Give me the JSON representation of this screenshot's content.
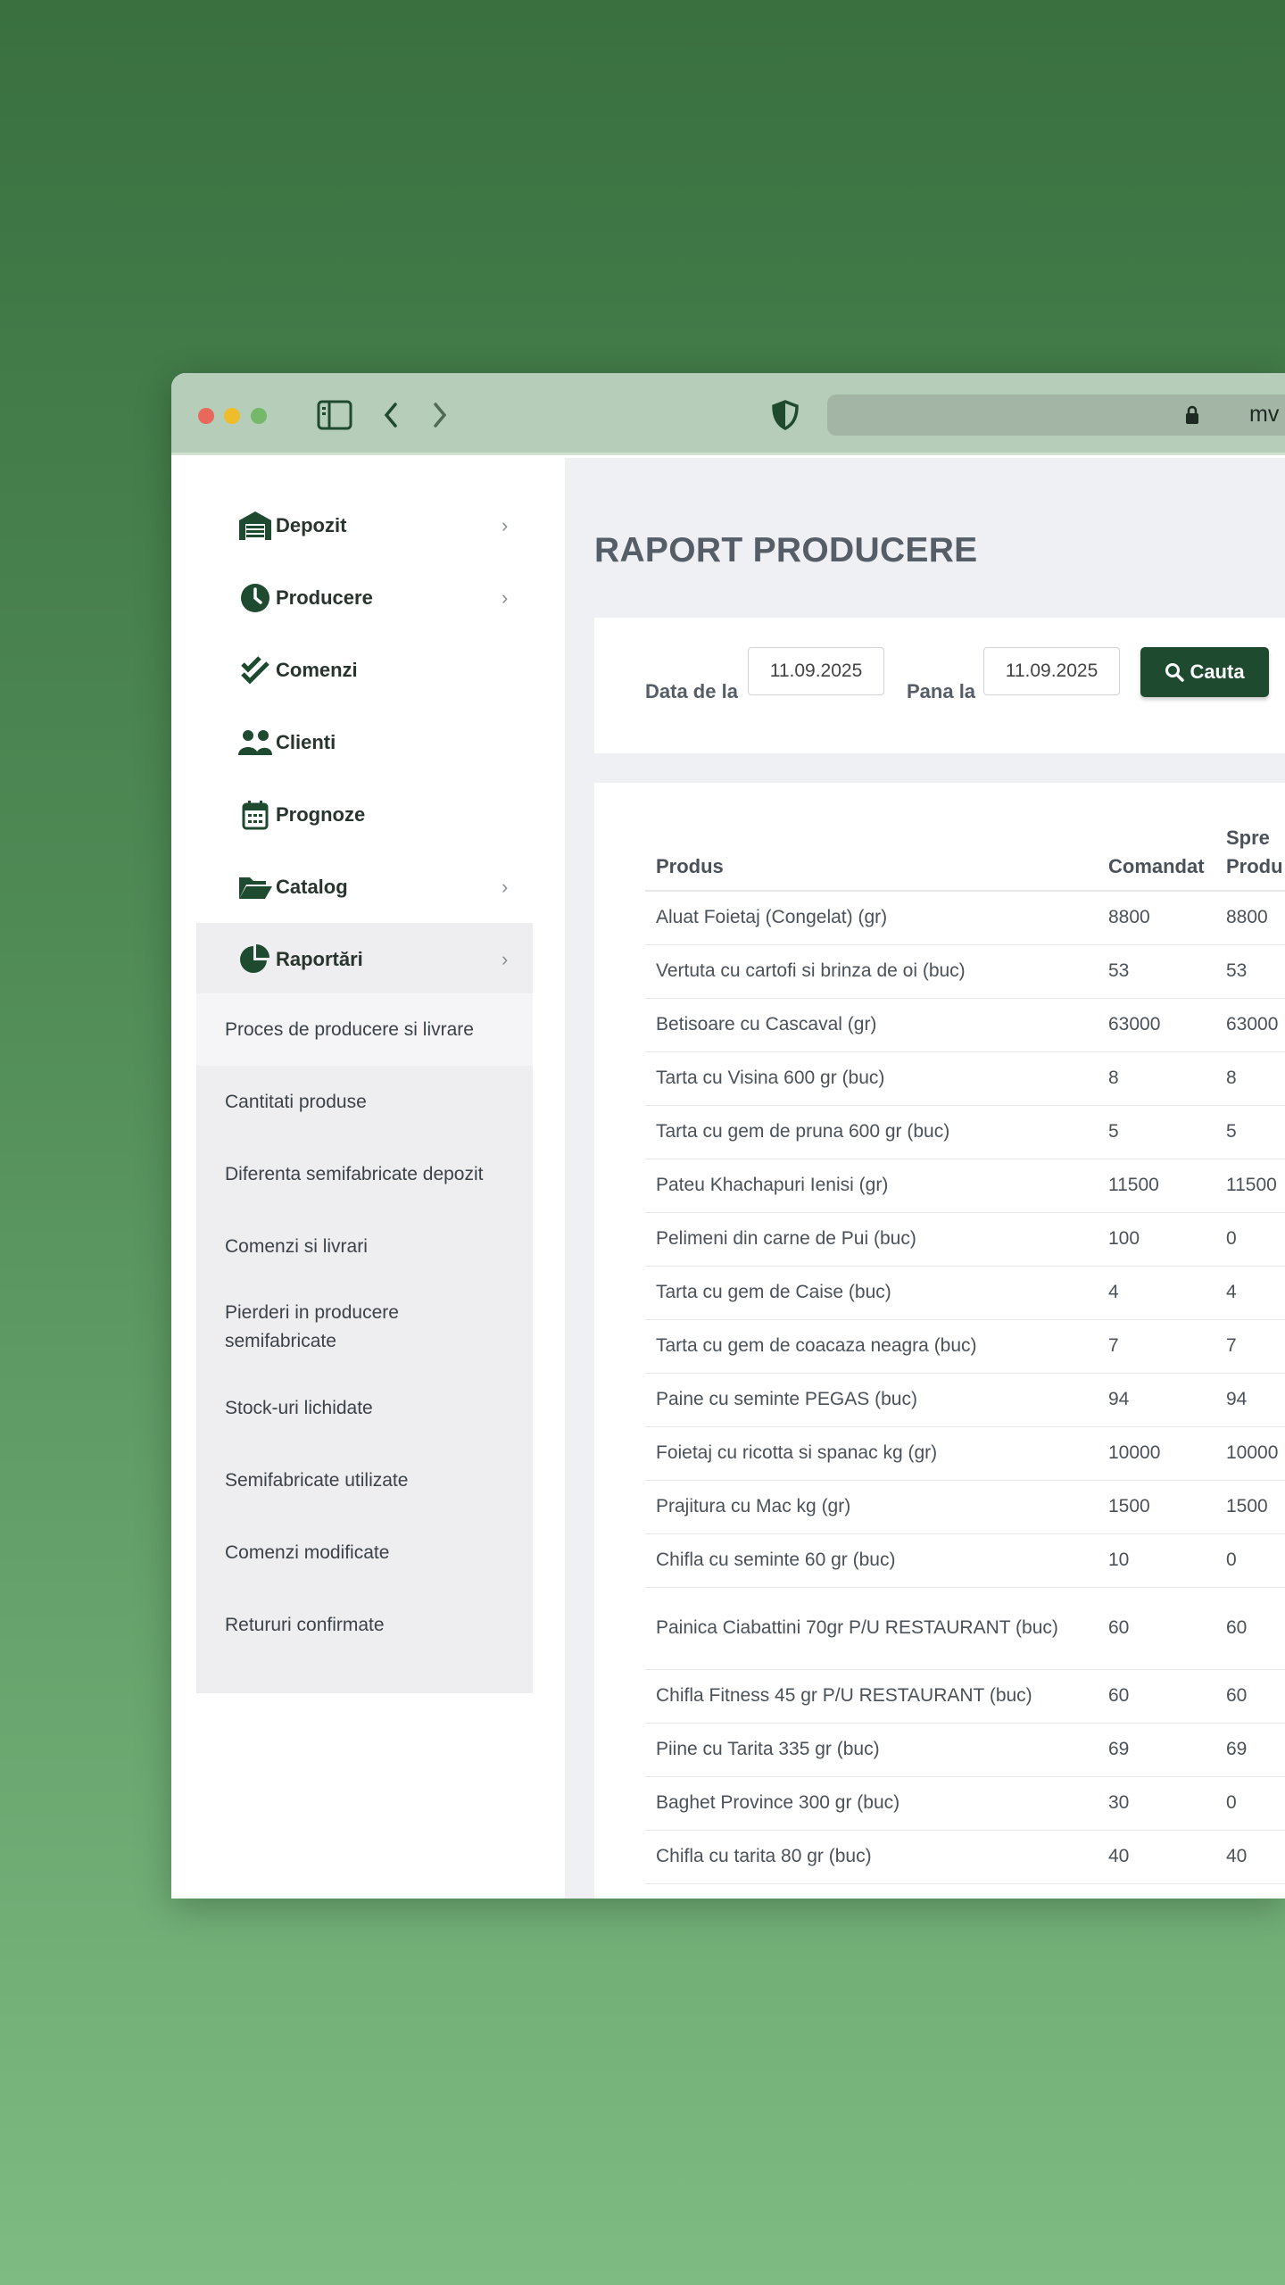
{
  "browser": {
    "url_partial": "mv",
    "colors": {
      "close": "#e8695c",
      "minimize": "#f0bd2a",
      "zoom": "#74b86a"
    }
  },
  "sidebar": {
    "items": [
      {
        "label": "Depozit",
        "icon": "warehouse-icon",
        "chevron": true
      },
      {
        "label": "Producere",
        "icon": "clock-icon",
        "chevron": true
      },
      {
        "label": "Comenzi",
        "icon": "double-check-icon",
        "chevron": false
      },
      {
        "label": "Clienti",
        "icon": "users-icon",
        "chevron": false
      },
      {
        "label": "Prognoze",
        "icon": "calendar-icon",
        "chevron": false
      },
      {
        "label": "Catalog",
        "icon": "folder-open-icon",
        "chevron": true
      },
      {
        "label": "Raportări",
        "icon": "pie-chart-icon",
        "chevron": true
      }
    ],
    "submenu": [
      {
        "label": "Proces de producere si livrare",
        "active": true
      },
      {
        "label": "Cantitati produse"
      },
      {
        "label": "Diferenta semifabricate depozit"
      },
      {
        "label": "Comenzi si livrari"
      },
      {
        "label": "Pierderi in producere semifabricate"
      },
      {
        "label": "Stock-uri lichidate"
      },
      {
        "label": "Semifabricate utilizate"
      },
      {
        "label": "Comenzi modificate"
      },
      {
        "label": "Retururi confirmate"
      }
    ]
  },
  "main": {
    "title": "RAPORT PRODUCERE",
    "filter": {
      "from_label": "Data de la",
      "from_value": "11.09.2025",
      "to_label": "Pana la",
      "to_value": "11.09.2025",
      "search_label": "Cauta"
    },
    "table": {
      "headers": [
        "Produs",
        "Comandat",
        "Spre Produ"
      ],
      "rows": [
        [
          "Aluat Foietaj (Congelat) (gr)",
          "8800",
          "8800"
        ],
        [
          "Vertuta cu cartofi si brinza de oi (buc)",
          "53",
          "53"
        ],
        [
          "Betisoare cu Cascaval (gr)",
          "63000",
          "63000"
        ],
        [
          "Tarta cu Visina 600 gr (buc)",
          "8",
          "8"
        ],
        [
          "Tarta cu gem de pruna 600 gr (buc)",
          "5",
          "5"
        ],
        [
          "Pateu Khachapuri Ienisi (gr)",
          "11500",
          "11500"
        ],
        [
          "Pelimeni din carne de Pui (buc)",
          "100",
          "0"
        ],
        [
          "Tarta cu gem de Caise (buc)",
          "4",
          "4"
        ],
        [
          "Tarta cu gem de coacaza neagra (buc)",
          "7",
          "7"
        ],
        [
          "Paine cu seminte PEGAS (buc)",
          "94",
          "94"
        ],
        [
          "Foietaj cu ricotta si spanac kg (gr)",
          "10000",
          "10000"
        ],
        [
          "Prajitura cu Mac kg (gr)",
          "1500",
          "1500"
        ],
        [
          "Chifla cu seminte 60 gr (buc)",
          "10",
          "0"
        ],
        [
          "Painica Ciabattini 70gr P/U RESTAURANT (buc)",
          "60",
          "60"
        ],
        [
          "Chifla Fitness 45 gr P/U RESTAURANT (buc)",
          "60",
          "60"
        ],
        [
          "Piine cu Tarita 335 gr (buc)",
          "69",
          "69"
        ],
        [
          "Baghet Province 300 gr (buc)",
          "30",
          "0"
        ],
        [
          "Chifla cu tarita 80 gr (buc)",
          "40",
          "40"
        ]
      ]
    }
  },
  "accent": "#1e4a30"
}
